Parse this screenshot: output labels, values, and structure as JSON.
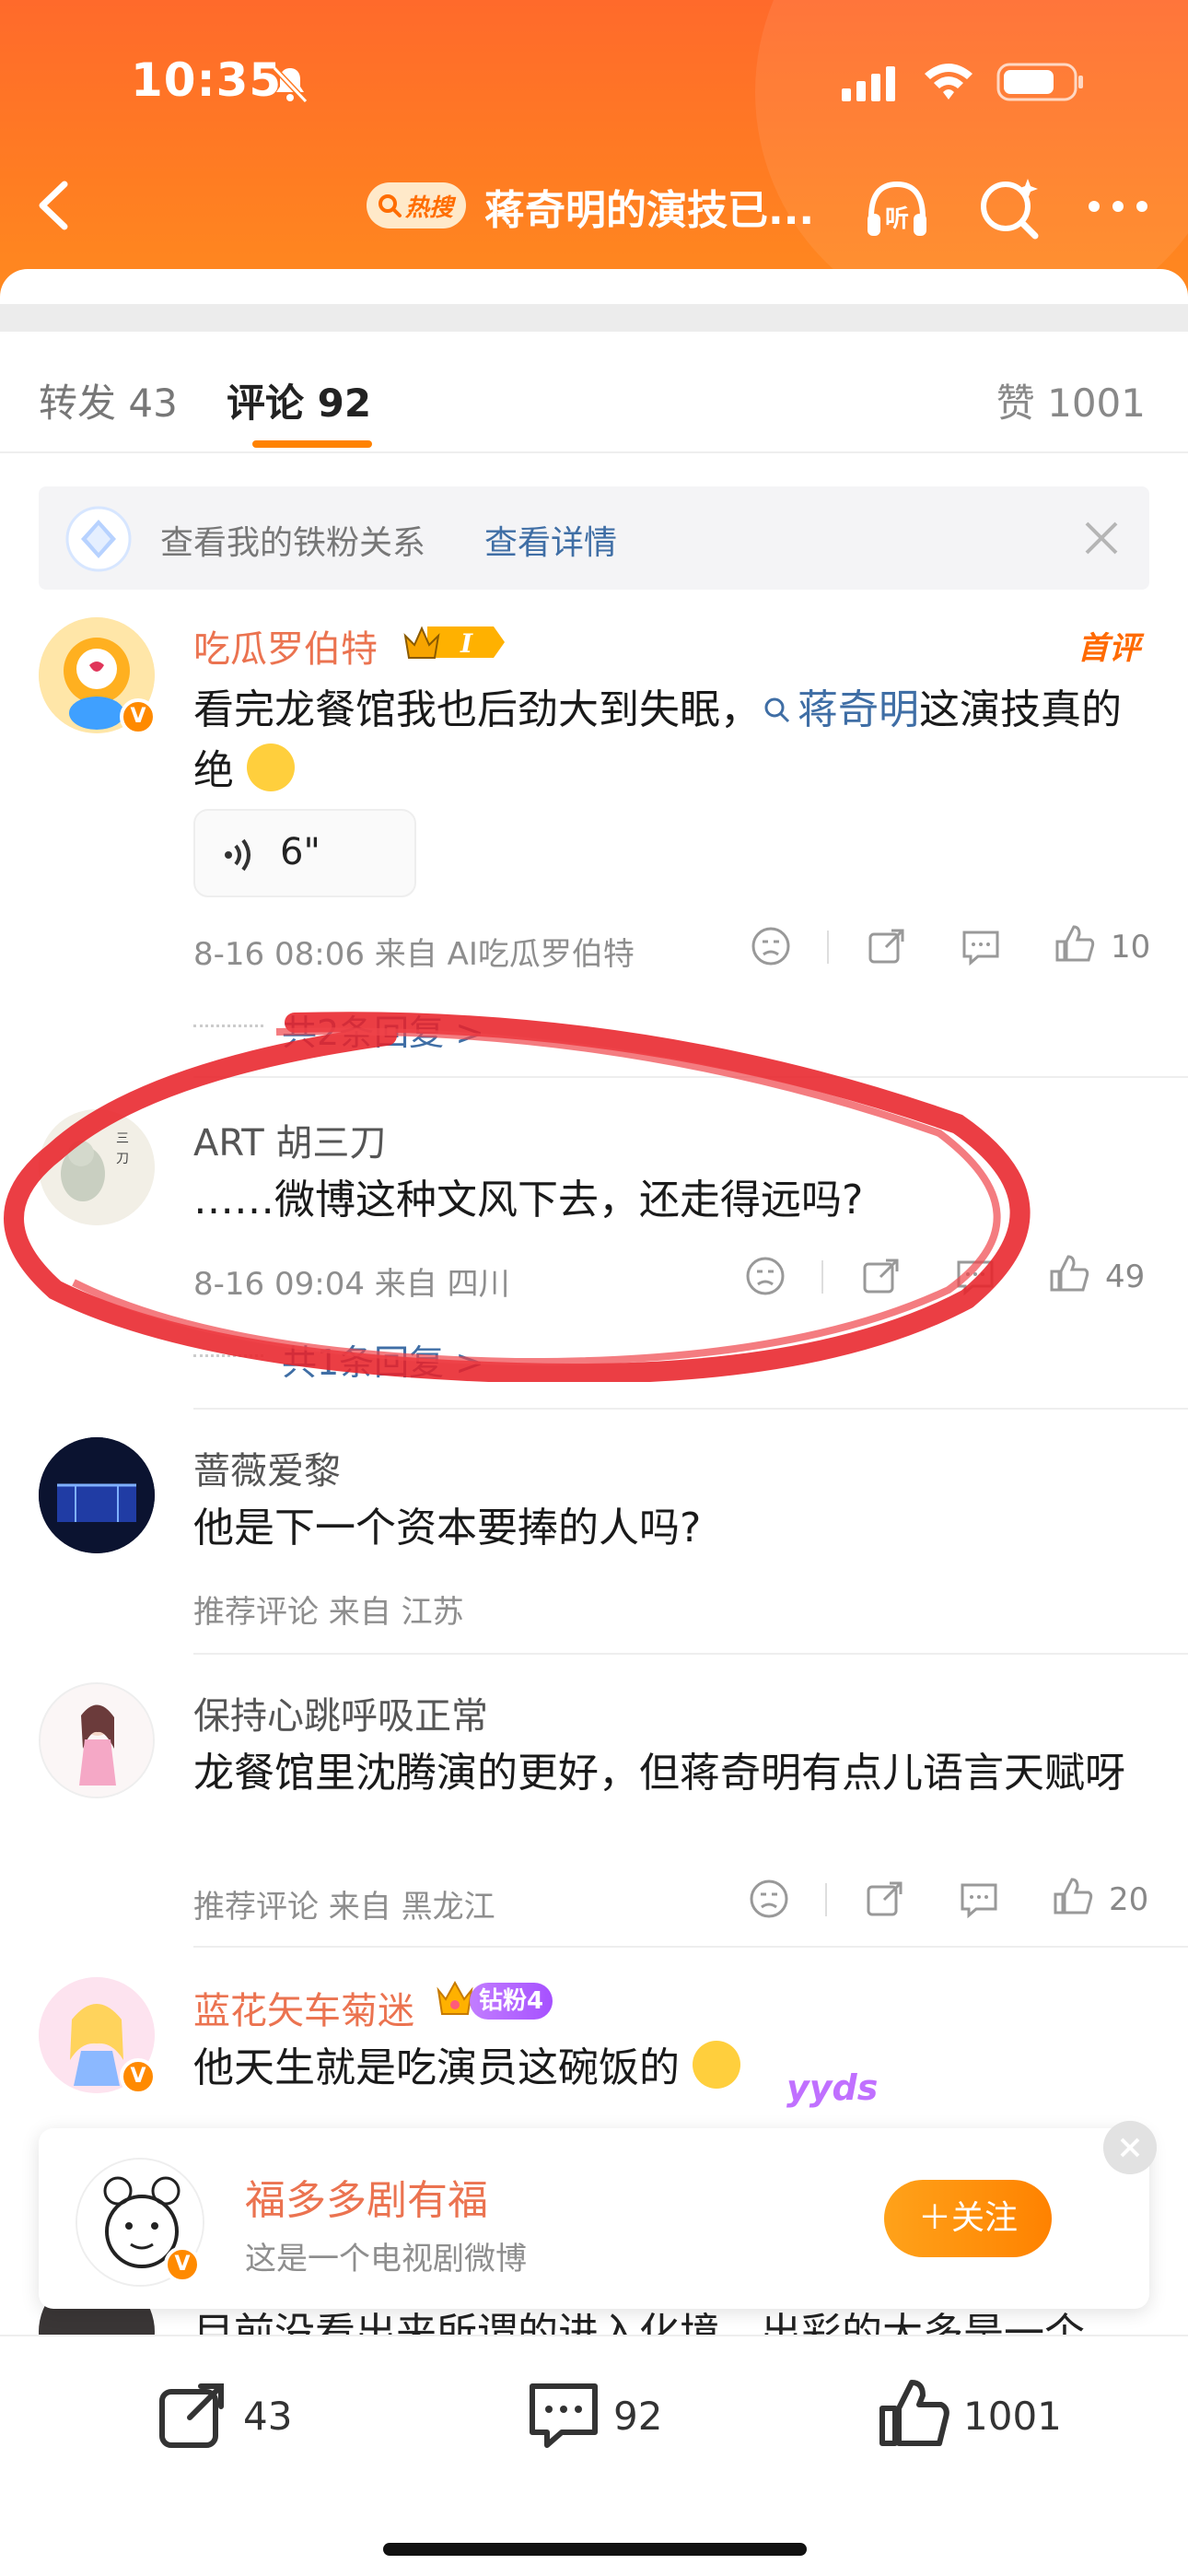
{
  "status_bar": {
    "time": "10:35"
  },
  "nav": {
    "hot_badge": "热搜",
    "title": "蒋奇明的演技已..."
  },
  "tabs": {
    "repost": "转发 43",
    "comment": "评论 92",
    "like": "赞 1001"
  },
  "fan_banner": {
    "text": "查看我的铁粉关系",
    "link": "查看详情"
  },
  "comments": [
    {
      "name": "吃瓜罗伯特",
      "tag": "首评",
      "text_a": "看完龙餐馆我也后劲大到失眠，",
      "topic": "蒋奇明",
      "text_b": "这演技真的绝",
      "voice_duration": "6\"",
      "meta": "8-16 08:06  来自 AI吃瓜罗伯特",
      "likes": "10",
      "replies": "共2条回复 >"
    },
    {
      "name": "ART 胡三刀",
      "text": "……微博这种文风下去，还走得远吗?",
      "meta": "8-16 09:04  来自 四川",
      "likes": "49",
      "replies": "共1条回复 >"
    },
    {
      "name": "蔷薇爱黎",
      "text": "他是下一个资本要捧的人吗?",
      "meta": "推荐评论  来自 江苏"
    },
    {
      "name": "保持心跳呼吸正常",
      "text": "龙餐馆里沈腾演的更好，但蒋奇明有点儿语言天赋呀",
      "meta": "推荐评论  来自 黑龙江",
      "likes": "20"
    },
    {
      "name": "蓝花矢车菊迷",
      "badge": "钻粉4",
      "text": "他天生就是吃演员这碗饭的",
      "sticker": "yyds"
    }
  ],
  "peek_comment": {
    "text": "目前没看出来所谓的进入化境，出彩的大多是一个"
  },
  "recommend": {
    "name": "福多多剧有福",
    "desc": "这是一个电视剧微博",
    "follow": "＋关注"
  },
  "bottom_bar": {
    "repost": "43",
    "comment": "92",
    "like": "1001"
  },
  "colors": {
    "brand_orange": "#ff8200",
    "name_orange": "#eb7350",
    "link_blue": "#3f6ea5"
  }
}
